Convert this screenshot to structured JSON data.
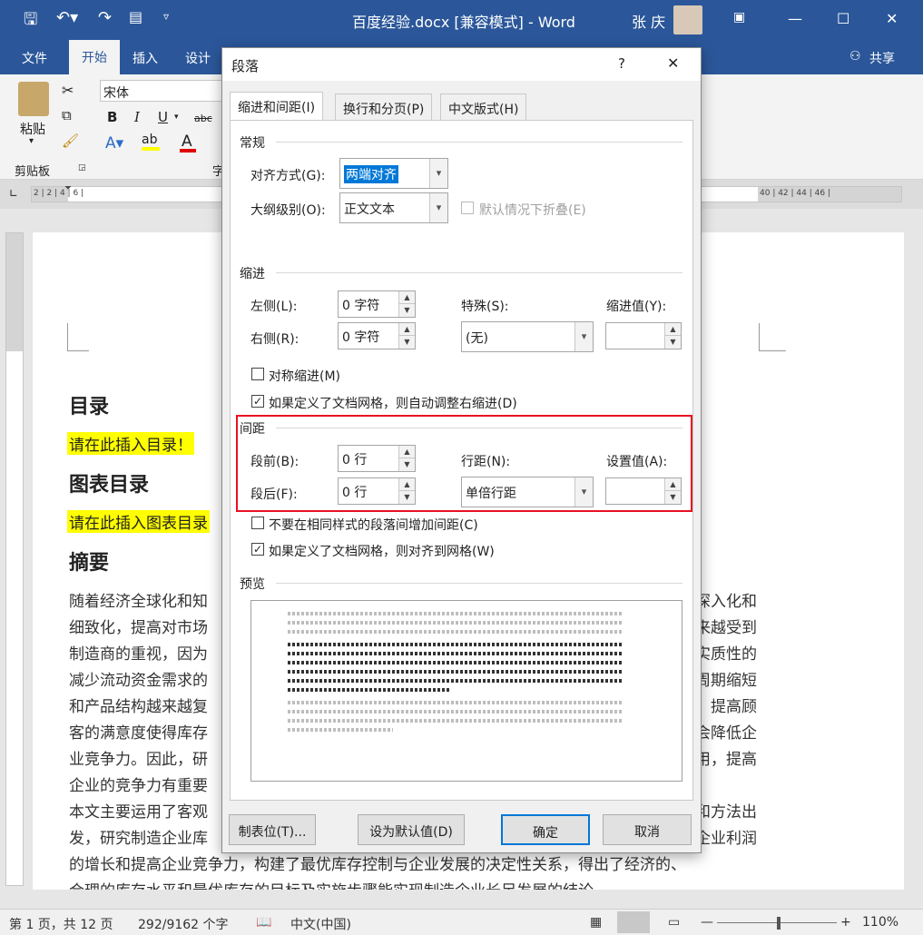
{
  "titlebar": {
    "title": "百度经验.docx [兼容模式] - Word",
    "user": "张 庆"
  },
  "tabs": {
    "file": "文件",
    "home": "开始",
    "insert": "插入",
    "design": "设计",
    "share": "共享"
  },
  "ribbon": {
    "paste": "粘贴",
    "clipboard": "剪贴板",
    "font_name": "宋体",
    "bold": "B",
    "italic": "I",
    "underline": "U",
    "strike": "abc",
    "group_font_partial": "字"
  },
  "ruler": {
    "left_marks": "2 | 2 | 4 | 6 |",
    "right_marks": "40 | 42 | 44 | 46 |"
  },
  "doc": {
    "h_toc": "目录",
    "toc_placeholder": "请在此插入目录！",
    "h_figs": "图表目录",
    "figs_placeholder": "请在此插入图表目录",
    "h_abstract": "摘要",
    "lines_left": [
      "随着经济全球化和知",
      "细致化，提高对市场",
      "制造商的重视，因为",
      "减少流动资金需求的",
      "和产品结构越来越复",
      "客的满意度使得库存",
      "业竞争力。因此，研",
      "企业的竞争力有重要",
      "本文主要运用了客观",
      "发，研究制造企业库"
    ],
    "lines_right": [
      "深入化和",
      "越来越受到",
      "实质性的",
      "周期缩短",
      "，提高顾",
      "会降低企",
      "用，提高",
      "",
      "和方法出",
      "企业利润"
    ],
    "line_full_1": "的增长和提高企业竞争力，构建了最优库存控制与企业发展的决定性关系，得出了经济的、",
    "line_full_2": "合理的库存水平和最优库存的目标及实施步骤能实现制造企业长足发展的结论。"
  },
  "dialog": {
    "title": "段落",
    "help": "?",
    "close": "✕",
    "tabs": [
      "缩进和间距(I)",
      "换行和分页(P)",
      "中文版式(H)"
    ],
    "general": {
      "section": "常规",
      "align_label": "对齐方式(G):",
      "align_value": "两端对齐",
      "outline_label": "大纲级别(O):",
      "outline_value": "正文文本",
      "collapse_label": "默认情况下折叠(E)"
    },
    "indent": {
      "section": "缩进",
      "left_label": "左侧(L):",
      "left_value": "0 字符",
      "right_label": "右侧(R):",
      "right_value": "0 字符",
      "special_label": "特殊(S):",
      "special_value": "(无)",
      "by_label": "缩进值(Y):",
      "by_value": "",
      "mirror_label": "对称缩进(M)",
      "auto_adjust_label": "如果定义了文档网格，则自动调整右缩进(D)"
    },
    "spacing": {
      "section": "间距",
      "before_label": "段前(B):",
      "before_value": "0 行",
      "after_label": "段后(F):",
      "after_value": "0 行",
      "line_label": "行距(N):",
      "line_value": "单倍行距",
      "at_label": "设置值(A):",
      "at_value": "",
      "no_space_label": "不要在相同样式的段落间增加间距(C)",
      "snap_label": "如果定义了文档网格，则对齐到网格(W)"
    },
    "preview": {
      "section": "预览"
    },
    "buttons": {
      "tabs": "制表位(T)...",
      "default": "设为默认值(D)",
      "ok": "确定",
      "cancel": "取消"
    }
  },
  "status": {
    "page": "第 1 页，共 12 页",
    "words": "292/9162 个字",
    "lang": "中文(中国)",
    "zoom": "110%"
  }
}
